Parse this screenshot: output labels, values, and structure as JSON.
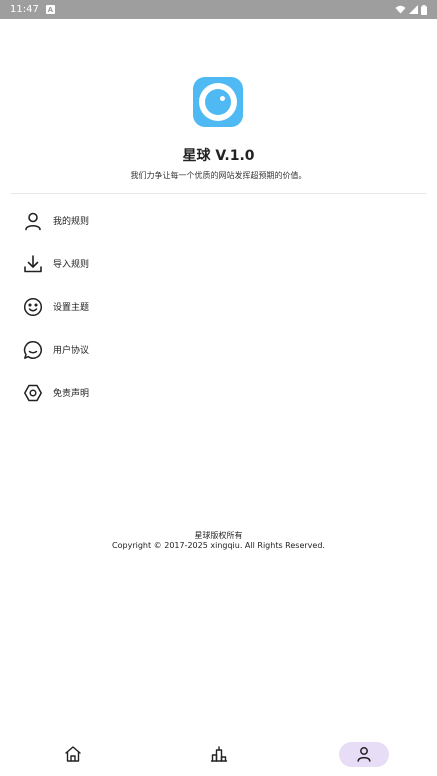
{
  "status_bar": {
    "time": "11:47",
    "notification_badge": "A"
  },
  "app": {
    "name_version": "星球 V.1.0",
    "tagline": "我们力争让每一个优质的网站发挥超预期的价值。"
  },
  "menu": {
    "items": [
      {
        "label": "我的规则",
        "icon": "user-icon"
      },
      {
        "label": "导入规则",
        "icon": "download-icon"
      },
      {
        "label": "设置主题",
        "icon": "smiley-icon"
      },
      {
        "label": "用户协议",
        "icon": "chat-bubble-icon"
      },
      {
        "label": "免责声明",
        "icon": "hexagon-icon"
      }
    ]
  },
  "footer": {
    "owner": "星球版权所有",
    "copyright": "Copyright © 2017-2025 xingqiu. All Rights Reserved."
  },
  "bottom_nav": {
    "tabs": [
      {
        "icon": "home-icon",
        "active": false
      },
      {
        "icon": "ranking-icon",
        "active": false
      },
      {
        "icon": "profile-icon",
        "active": true
      }
    ]
  },
  "colors": {
    "accent": "#4fb9f4",
    "active_tab_bg": "#e8ddf7",
    "status_bar": "#9e9e9e"
  }
}
